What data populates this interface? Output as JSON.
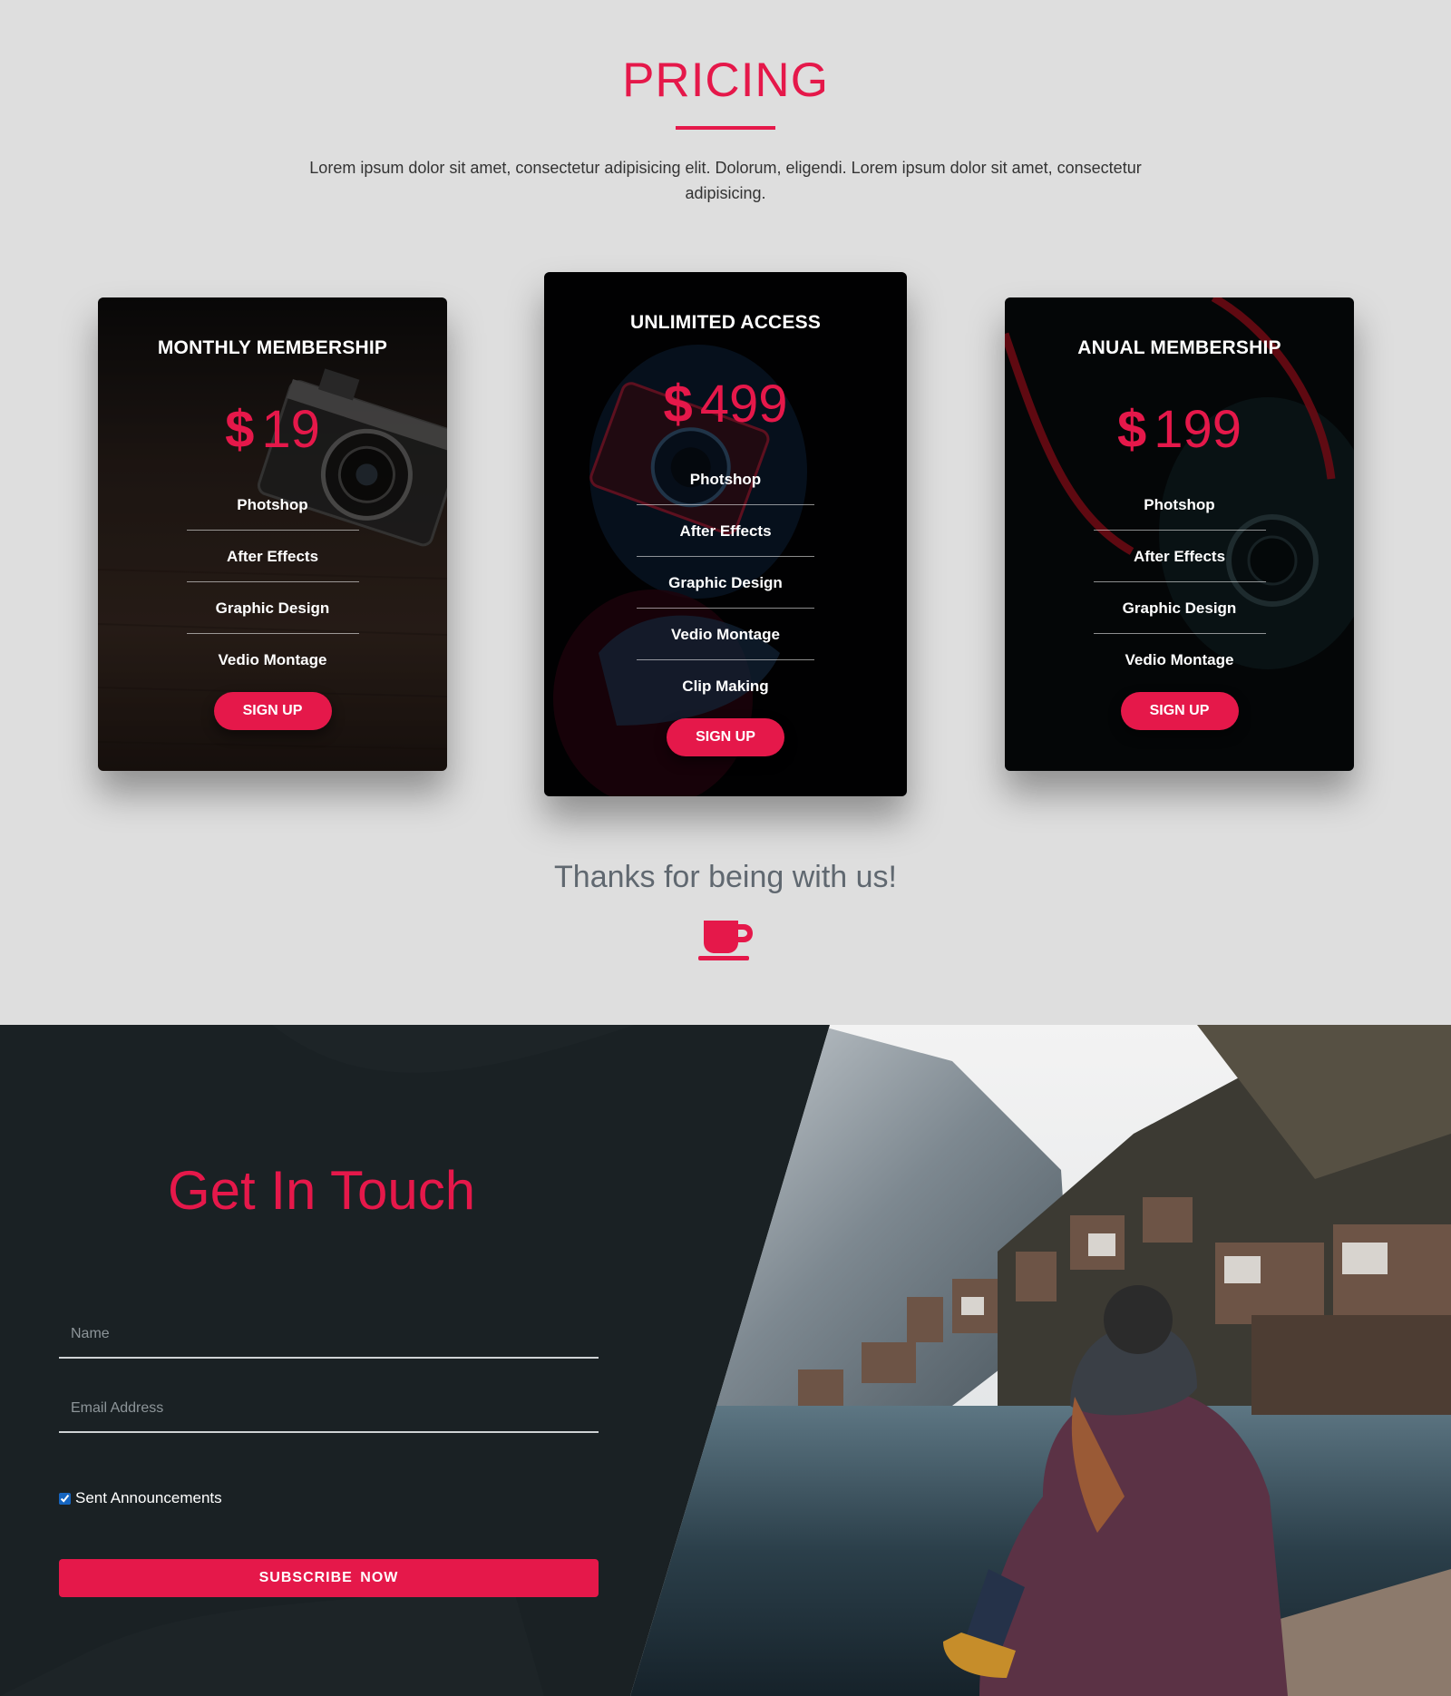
{
  "pricing": {
    "title": "PRICING",
    "description": "Lorem ipsum dolor sit amet, consectetur adipisicing elit. Dolorum, eligendi. Lorem ipsum dolor sit amet, consectetur adipisicing.",
    "plans": [
      {
        "title": "MONTHLY MEMBERSHIP",
        "currency": "$",
        "price": "19",
        "features": [
          "Photshop",
          "After Effects",
          "Graphic Design",
          "Vedio Montage"
        ],
        "cta": "SIGN UP"
      },
      {
        "title": "UNLIMITED ACCESS",
        "currency": "$",
        "price": "499",
        "features": [
          "Photshop",
          "After Effects",
          "Graphic Design",
          "Vedio Montage",
          "Clip Making"
        ],
        "cta": "SIGN UP"
      },
      {
        "title": "ANUAL MEMBERSHIP",
        "currency": "$",
        "price": "199",
        "features": [
          "Photshop",
          "After Effects",
          "Graphic Design",
          "Vedio Montage"
        ],
        "cta": "SIGN UP"
      }
    ],
    "thanks": "Thanks for being with us!",
    "thanks_icon": "coffee-cup-icon"
  },
  "contact": {
    "title": "Get In Touch",
    "name_placeholder": "Name",
    "email_placeholder": "Email Address",
    "checkbox_label": "Sent Announcements",
    "checkbox_checked": true,
    "submit_label": "SUBSCRIBE  NOW"
  },
  "colors": {
    "accent": "#e5184a",
    "page_bg": "#dedede",
    "dark_panel": "#1a2124"
  }
}
